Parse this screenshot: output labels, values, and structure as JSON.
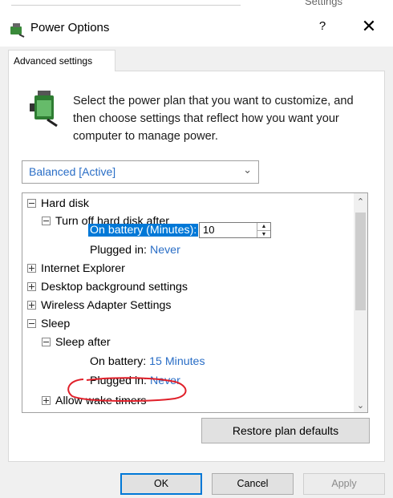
{
  "background": {
    "partial_text": "Settings"
  },
  "window": {
    "title": "Power Options",
    "help": "?",
    "close": "✕"
  },
  "tab": {
    "label": "Advanced settings"
  },
  "description": "Select the power plan that you want to customize, and then choose settings that reflect how you want your computer to manage power.",
  "plan_select": {
    "value": "Balanced [Active]"
  },
  "tree": {
    "hard_disk": "Hard disk",
    "turn_off_after": "Turn off hard disk after",
    "on_battery_label": "On battery (Minutes):",
    "on_battery_value": "10",
    "plugged_in_label": "Plugged in:",
    "plugged_in_value": "Never",
    "internet_explorer": "Internet Explorer",
    "desktop_background": "Desktop background settings",
    "wireless_adapter": "Wireless Adapter Settings",
    "sleep": "Sleep",
    "sleep_after": "Sleep after",
    "sleep_on_battery_label": "On battery:",
    "sleep_on_battery_value": "15 Minutes",
    "sleep_plugged_in_label": "Plugged in:",
    "sleep_plugged_in_value": "Never",
    "allow_wake_timers": "Allow wake timers"
  },
  "buttons": {
    "restore": "Restore plan defaults",
    "ok": "OK",
    "cancel": "Cancel",
    "apply": "Apply"
  },
  "colors": {
    "selection": "#0078d7",
    "value_link": "#2a6ec6",
    "annotation": "#e0202a"
  }
}
